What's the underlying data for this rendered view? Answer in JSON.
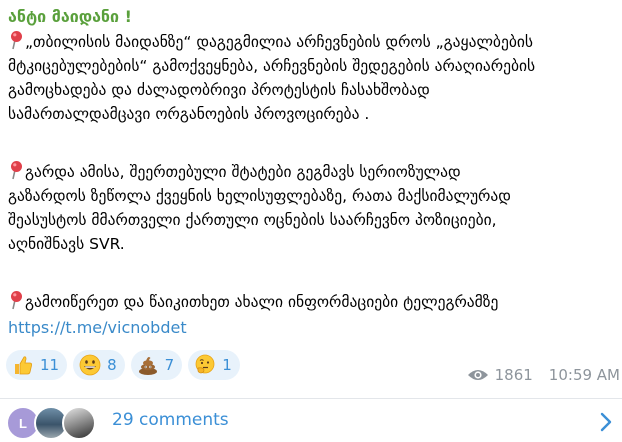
{
  "post": {
    "title": "ანტი მაიდანი !",
    "paragraph1": [
      "„თბილისის მაიდანზე“ დაგეგმილია არჩევნების დროს „გაყალბების",
      "მტკიცებულებების“ გამოქვეყნება, არჩევნების შედეგების არაღიარების",
      "გამოცხადება და ძალადობრივი პროტესტის ჩასახშობად",
      "სამართალდამცავი ორგანოების პროვოცირება ."
    ],
    "paragraph2": [
      "გარდა ამისა, შეერთებული შტატები გეგმავს სერიოზულად",
      "გაზარდოს ზეწოლა ქვეყნის ხელისუფლებაზე, რათა მაქსიმალურად",
      "შეასუსტოს მმართველი ქართული ოცნების საარჩევნო პოზიციები,",
      "აღნიშნავს SVR."
    ],
    "paragraph3": [
      "გამოიწერეთ და წაიკითხეთ ახალი ინფორმაციები ტელეგრამზე"
    ],
    "link": "https://t.me/vicnobdet",
    "pin_icon": "round-pushpin-icon"
  },
  "reactions": [
    {
      "emoji": "thumbs-up-icon",
      "count": "11"
    },
    {
      "emoji": "grinning-face-icon",
      "count": "8"
    },
    {
      "emoji": "pile-of-poo-icon",
      "count": "7"
    },
    {
      "emoji": "thinking-face-icon",
      "count": "1"
    }
  ],
  "meta": {
    "views": "1861",
    "time": "10:59 AM"
  },
  "comments": {
    "avatar_initial": "L",
    "label": "29 comments"
  },
  "colors": {
    "title": "#5aa03c",
    "link": "#3a8ac9",
    "reaction_bg": "#e8f2fb",
    "reaction_text": "#3b8fd6",
    "meta": "#8e959c",
    "avatar_l": "#a79ad8"
  }
}
